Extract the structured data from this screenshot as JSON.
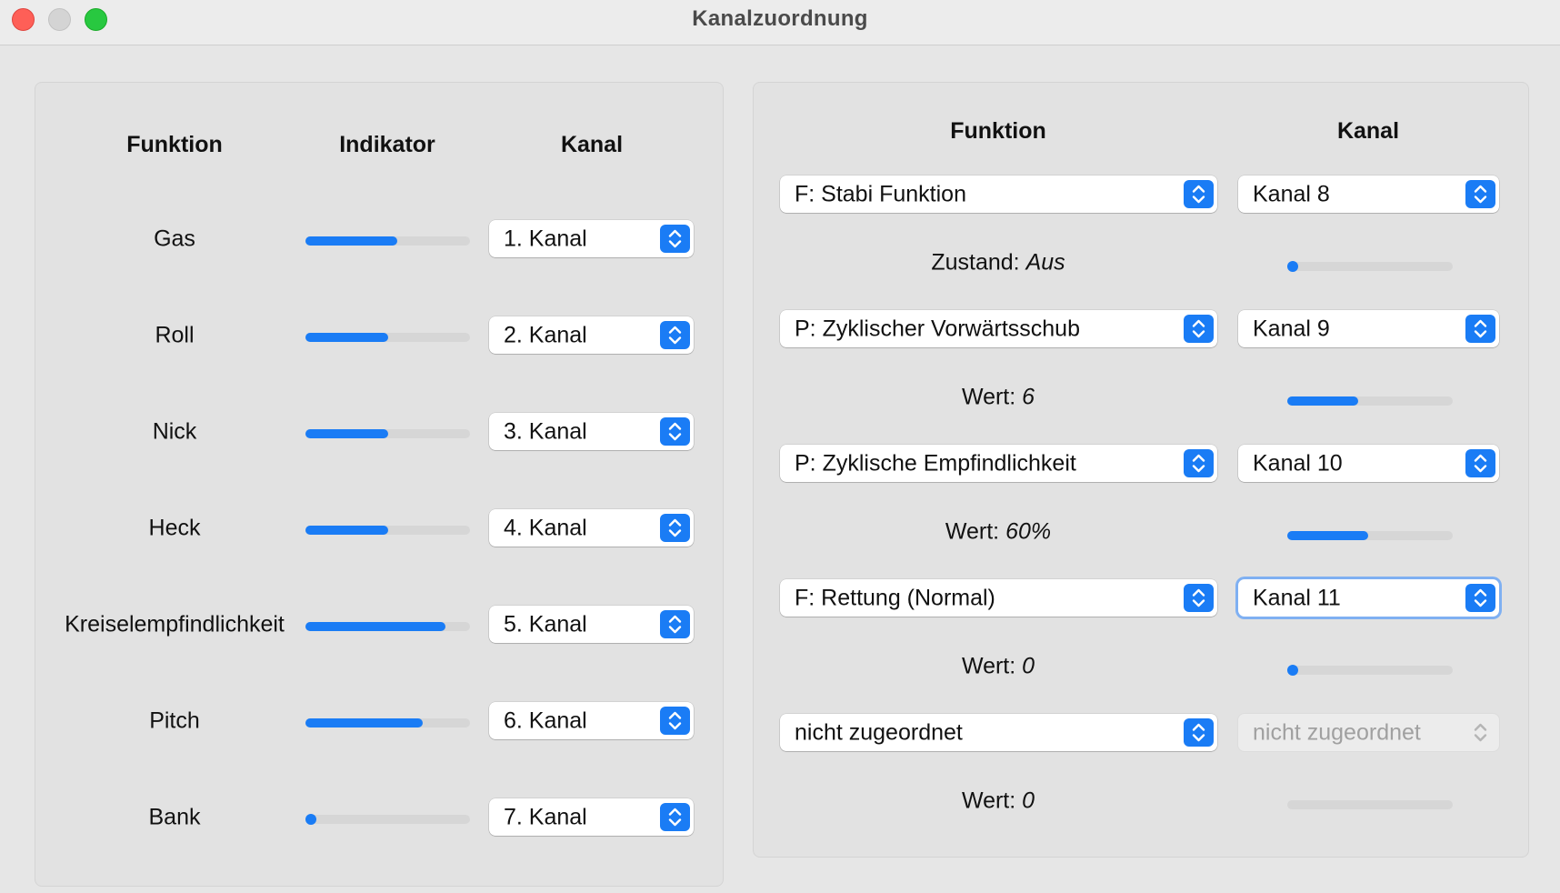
{
  "window": {
    "title": "Kanalzuordnung"
  },
  "left": {
    "headers": {
      "function": "Funktion",
      "indicator": "Indikator",
      "channel": "Kanal"
    },
    "rows": [
      {
        "function": "Gas",
        "level": 0.56,
        "channel": "1. Kanal"
      },
      {
        "function": "Roll",
        "level": 0.5,
        "channel": "2. Kanal"
      },
      {
        "function": "Nick",
        "level": 0.5,
        "channel": "3. Kanal"
      },
      {
        "function": "Heck",
        "level": 0.5,
        "channel": "4. Kanal"
      },
      {
        "function": "Kreiselempfindlichkeit",
        "level": 0.85,
        "channel": "5. Kanal"
      },
      {
        "function": "Pitch",
        "level": 0.71,
        "channel": "6. Kanal"
      },
      {
        "function": "Bank",
        "level": 0.0,
        "channel": "7. Kanal"
      }
    ]
  },
  "right": {
    "headers": {
      "function": "Funktion",
      "channel": "Kanal"
    },
    "rows": [
      {
        "function": "F: Stabi Funktion",
        "channel": "Kanal 8",
        "state_label": "Zustand:",
        "state_value": "Aus",
        "level": 0.0
      },
      {
        "function": "P: Zyklischer Vorwärtsschub",
        "channel": "Kanal 9",
        "state_label": "Wert:",
        "state_value": "6",
        "level": 0.43
      },
      {
        "function": "P: Zyklische Empfindlichkeit",
        "channel": "Kanal 10",
        "state_label": "Wert:",
        "state_value": "60%",
        "level": 0.49
      },
      {
        "function": "F: Rettung (Normal)",
        "channel": "Kanal 11",
        "state_label": "Wert:",
        "state_value": "0",
        "level": 0.0,
        "focused": true
      },
      {
        "function": "nicht zugeordnet",
        "channel": "nicht zugeordnet",
        "state_label": "Wert:",
        "state_value": "0",
        "level": null,
        "disabled": true
      }
    ]
  },
  "colors": {
    "accent": "#1a7cf5",
    "track": "#d6d6d6",
    "focus_ring": "#7fb0f2"
  },
  "icons": {
    "stepper": "up-down-chevron-icon"
  }
}
